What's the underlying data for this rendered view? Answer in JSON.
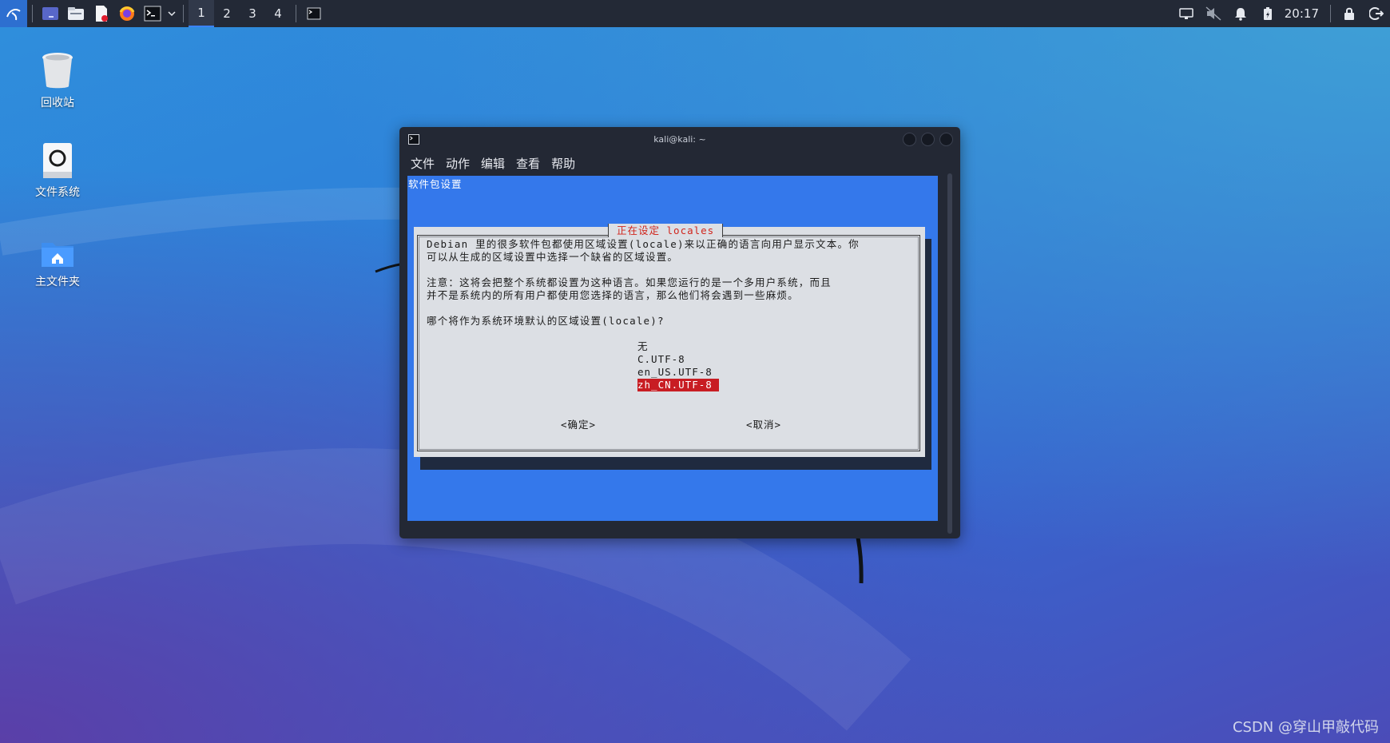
{
  "panel": {
    "workspaces": [
      "1",
      "2",
      "3",
      "4"
    ],
    "active_workspace": "1",
    "clock": "20:17"
  },
  "desktop": {
    "icons": [
      {
        "label": "回收站",
        "icon": "trash-icon"
      },
      {
        "label": "文件系统",
        "icon": "drive-icon"
      },
      {
        "label": "主文件夹",
        "icon": "home-folder-icon"
      }
    ]
  },
  "window": {
    "title": "kali@kali: ~",
    "menu": [
      "文件",
      "动作",
      "编辑",
      "查看",
      "帮助"
    ]
  },
  "terminal": {
    "header": "软件包设置",
    "dialog": {
      "title": "正在设定 locales",
      "lines": [
        "Debian 里的很多软件包都使用区域设置(locale)来以正确的语言向用户显示文本。你",
        "可以从生成的区域设置中选择一个缺省的区域设置。",
        "注意：这将会把整个系统都设置为这种语言。如果您运行的是一个多用户系统，而且",
        "并不是系统内的所有用户都使用您选择的语言，那么他们将会遇到一些麻烦。",
        "哪个将作为系统环境默认的区域设置(locale)?"
      ],
      "options": [
        "无",
        "C.UTF-8",
        "en_US.UTF-8",
        "zh_CN.UTF-8"
      ],
      "selected_option": "zh_CN.UTF-8",
      "ok_label": "<确定>",
      "cancel_label": "<取消>"
    }
  },
  "watermark": "CSDN @穿山甲敲代码",
  "colors": {
    "panel_bg": "#232936",
    "terminal_bg": "#3478eb",
    "dialog_bg": "#dcdfe4",
    "dialog_title": "#d0261d",
    "selection_bg": "#c81d23"
  }
}
